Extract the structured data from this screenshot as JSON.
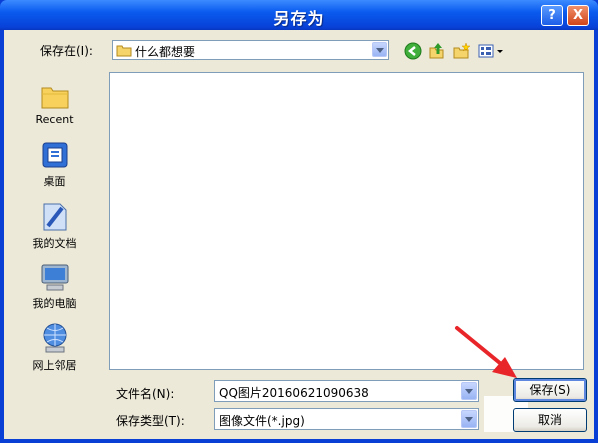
{
  "window": {
    "title": "另存为"
  },
  "titlebar": {
    "help_label": "?",
    "close_label": "X"
  },
  "lookin": {
    "label": "保存在(I):",
    "value": "什么都想要"
  },
  "places": [
    {
      "label": "Recent"
    },
    {
      "label": "桌面"
    },
    {
      "label": "我的文档"
    },
    {
      "label": "我的电脑"
    },
    {
      "label": "网上邻居"
    }
  ],
  "filename": {
    "label": "文件名(N):",
    "value": "QQ图片20160621090638"
  },
  "filetype": {
    "label": "保存类型(T):",
    "value": "图像文件(*.jpg)"
  },
  "buttons": {
    "save": "保存(S)",
    "cancel": "取消"
  },
  "colors": {
    "titlebar": "#0a5bef",
    "client": "#ece9d8",
    "annotation_arrow": "#e8262a"
  },
  "icons": [
    "help-icon",
    "close-icon",
    "folder-icon",
    "back-icon",
    "up-folder-icon",
    "new-folder-icon",
    "view-menu-icon",
    "recent-icon",
    "desktop-icon",
    "documents-icon",
    "computer-icon",
    "network-icon"
  ]
}
